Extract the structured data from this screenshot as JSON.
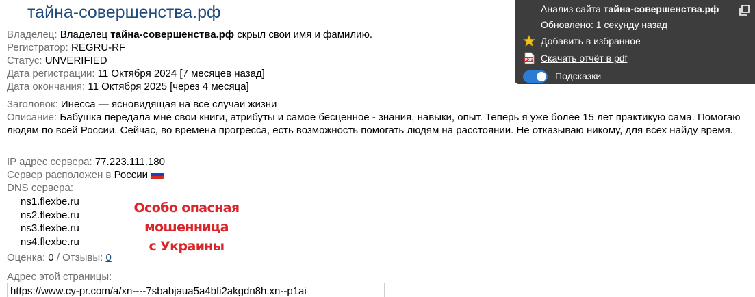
{
  "site": {
    "title": "тайна-совершенства.рф"
  },
  "whois": {
    "owner_label": "Владелец:",
    "owner_text_before": "Владелец",
    "owner_domain": "тайна-совершенства.рф",
    "owner_text_after": "скрыл свои имя и фамилию.",
    "registrar_label": "Регистратор:",
    "registrar_value": "REGRU-RF",
    "status_label": "Статус:",
    "status_value": "UNVERIFIED",
    "reg_date_label": "Дата регистрации:",
    "reg_date_value": "11 Октября 2024 [7 месяцев назад]",
    "exp_date_label": "Дата окончания:",
    "exp_date_value": "11 Октября 2025 [через 4 месяца]"
  },
  "meta": {
    "heading_label": "Заголовок:",
    "heading_value": "Инесса — ясновидящая на все случаи жизни",
    "description_label": "Описание:",
    "description_value": "Бабушка передала мне свои книги, атрибуты и самое бесценное - знания, навыки, опыт. Теперь я уже более 15 лет практикую сама. Помогаю людям по всей России. Сейчас, во времена прогресса, есть возможность помогать людям на расстоянии. Не отказываю никому, для всех найду время."
  },
  "server": {
    "ip_label": "IP адрес сервера:",
    "ip_value": "77.223.111.180",
    "location_label": "Сервер расположен в",
    "location_value": "России",
    "flag_icon": "russia-flag-icon",
    "flag_colors": [
      "#ffffff",
      "#1c3fbf",
      "#d52b1e"
    ],
    "dns_label": "DNS сервера:",
    "dns": [
      "ns1.flexbe.ru",
      "ns2.flexbe.ru",
      "ns3.flexbe.ru",
      "ns4.flexbe.ru"
    ]
  },
  "warning": {
    "line1": "Особо опасная мошенница",
    "line2": "с Украины",
    "color": "#d9262b"
  },
  "rating": {
    "score_label": "Оценка:",
    "score_value": "0",
    "separator": "/",
    "reviews_label": "Отзывы:",
    "reviews_value": "0"
  },
  "page_address": {
    "label": "Адрес этой страницы:",
    "value": "https://www.cy-pr.com/a/xn----7sbabjaua5a4bfi2akgdn8h.xn--p1ai"
  },
  "panel": {
    "analysis_prefix": "Анализ сайта",
    "analysis_domain": "тайна-совершенства.рф",
    "updated": "Обновлено: 1 секунду назад",
    "favorites": "Добавить в избранное",
    "pdf": "Скачать отчёт в pdf",
    "hints": "Подсказки",
    "hints_on": true,
    "background": "#3d3d3d",
    "toggle_color": "#2d7cd3"
  },
  "colors": {
    "title": "#1f4a7a",
    "label": "#707070"
  }
}
